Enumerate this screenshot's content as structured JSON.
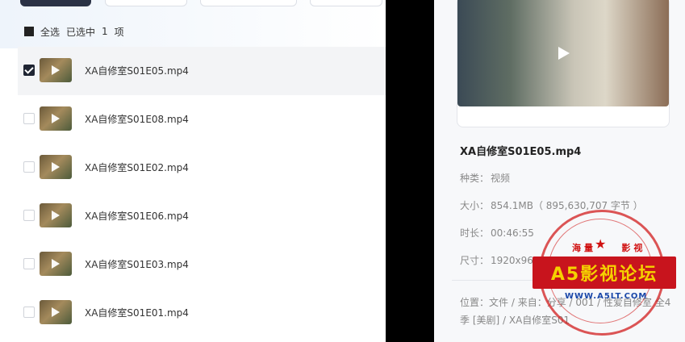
{
  "selection": {
    "select_all": "全选",
    "selected": "已选中",
    "count": "1",
    "unit": "项"
  },
  "files": [
    {
      "name": "XA自修室S01E05.mp4",
      "checked": true
    },
    {
      "name": "XA自修室S01E08.mp4",
      "checked": false
    },
    {
      "name": "XA自修室S01E02.mp4",
      "checked": false
    },
    {
      "name": "XA自修室S01E06.mp4",
      "checked": false
    },
    {
      "name": "XA自修室S01E03.mp4",
      "checked": false
    },
    {
      "name": "XA自修室S01E01.mp4",
      "checked": false
    }
  ],
  "details": {
    "title": "XA自修室S01E05.mp4",
    "type_label": "种类：",
    "type_value": "视频",
    "size_label": "大小：",
    "size_value": "854.1MB（ 895,630,707 字节 ）",
    "duration_label": "时长：",
    "duration_value": "00:46:55",
    "dimension_label": "尺寸：",
    "dimension_value": "1920x960",
    "location_label": "位置：",
    "location_value": "文件 / 来自：分享 / 001 / 性爱自修室 全4季 [美剧] / XA自修室S01"
  },
  "watermark": {
    "top": "海量",
    "top2": "影视",
    "banner": "A5影视论坛",
    "url": "WWW.A5LT.COM"
  },
  "colors": {
    "checked": "#1f2533",
    "watermark_red": "#c8141d",
    "watermark_yellow": "#f5d100"
  }
}
